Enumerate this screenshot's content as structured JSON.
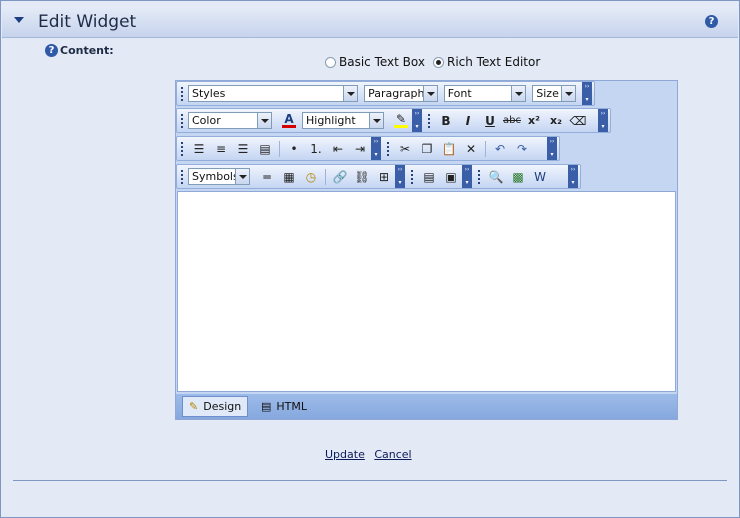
{
  "header": {
    "title": "Edit Widget",
    "help_icon": "question-icon"
  },
  "content_label": "Content:",
  "mode_select": {
    "options": [
      {
        "label": "Basic Text Box",
        "selected": false
      },
      {
        "label": "Rich Text Editor",
        "selected": true
      }
    ]
  },
  "toolbar1": {
    "styles": "Styles",
    "paragraph": "Paragraph",
    "font": "Font",
    "size": "Size"
  },
  "toolbar2": {
    "color": "Color",
    "highlight": "Highlight",
    "icons": [
      "font-color-icon",
      "highlight-icon",
      "bold-icon",
      "italic-icon",
      "underline-icon",
      "strikethrough-icon",
      "superscript-icon",
      "subscript-icon",
      "eraser-icon"
    ]
  },
  "toolbar3": {
    "icons": [
      "align-left-icon",
      "align-center-icon",
      "align-right-icon",
      "justify-icon",
      "bullet-list-icon",
      "numbered-list-icon",
      "outdent-icon",
      "indent-icon",
      "cut-icon",
      "copy-icon",
      "paste-icon",
      "delete-icon",
      "undo-icon",
      "redo-icon"
    ]
  },
  "toolbar4": {
    "symbols": "Symbols",
    "icons": [
      "horizontal-rule-icon",
      "table-icon",
      "date-time-icon",
      "link-icon",
      "unlink-icon",
      "table-properties-icon",
      "insert-table-icon",
      "cell-properties-icon",
      "preview-icon",
      "select-all-icon",
      "word-clean-icon"
    ]
  },
  "editor": {
    "modes": [
      "Design",
      "HTML"
    ],
    "active_mode": "Design"
  },
  "actions": {
    "update": "Update",
    "cancel": "Cancel"
  },
  "colors": {
    "accent": "#3a5fa8",
    "background": "#e3e9f5",
    "font_color_bar": "#d40000",
    "highlight_bar": "#ffff00"
  }
}
